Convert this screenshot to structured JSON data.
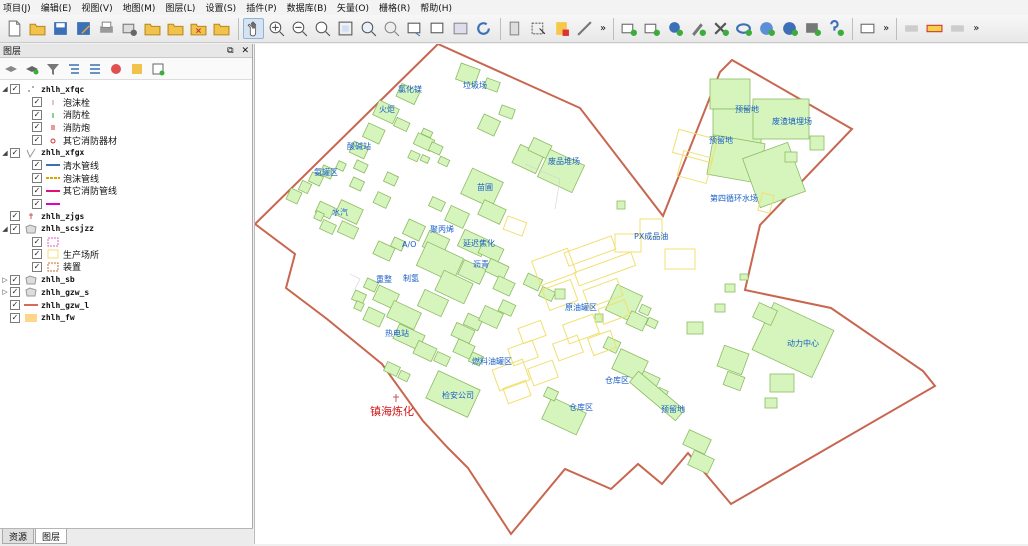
{
  "menu": [
    "项目(J)",
    "编辑(E)",
    "视图(V)",
    "地图(M)",
    "图层(L)",
    "设置(S)",
    "插件(P)",
    "数据库(B)",
    "矢量(O)",
    "栅格(R)",
    "帮助(H)"
  ],
  "toolbar": {
    "more1": "»",
    "more2": "»",
    "more3": "»"
  },
  "panel": {
    "title": "图层",
    "float_glyph": "⧉",
    "close_glyph": "✕"
  },
  "layers": {
    "xfqc": {
      "name": "zhlh_xfqc",
      "items": [
        "泡沫栓",
        "消防栓",
        "消防炮",
        "其它消防器材"
      ]
    },
    "xfgx": {
      "name": "zhlh_xfgx",
      "items": [
        "清水管线",
        "泡沫管线",
        "其它消防管线",
        ""
      ]
    },
    "zjgs": {
      "name": "zhlh_zjgs"
    },
    "scsjzz": {
      "name": "zhlh_scsjzz",
      "items": [
        "",
        "生产场所",
        "装置"
      ]
    },
    "sb": {
      "name": "zhlh_sb"
    },
    "gzw_s": {
      "name": "zhlh_gzw_s"
    },
    "gzw_l": {
      "name": "zhlh_gzw_l"
    },
    "fw": {
      "name": "zhlh_fw"
    }
  },
  "tabs": {
    "resource": "资源",
    "layers": "图层"
  },
  "map": {
    "labels": [
      {
        "t": "垃圾场"
      },
      {
        "t": "氯化镁"
      },
      {
        "t": "火炬"
      },
      {
        "t": "酸碱站"
      },
      {
        "t": "氨罐区"
      },
      {
        "t": "水汽"
      },
      {
        "t": "苗圃"
      },
      {
        "t": "废品堆场"
      },
      {
        "t": "聚丙烯"
      },
      {
        "t": "延迟焦化"
      },
      {
        "t": "A/O"
      },
      {
        "t": "沥青"
      },
      {
        "t": "重整"
      },
      {
        "t": "制氢"
      },
      {
        "t": "PX成品油"
      },
      {
        "t": "原油罐区"
      },
      {
        "t": "热电站"
      },
      {
        "t": "燃料油罐区"
      },
      {
        "t": "仓库区"
      },
      {
        "t": "检安公司"
      },
      {
        "t": "仓库区"
      },
      {
        "t": "预留地"
      },
      {
        "t": "预留地"
      },
      {
        "t": "废渣填埋场"
      },
      {
        "t": "预留地"
      },
      {
        "t": "第四循环水场"
      },
      {
        "t": "动力中心"
      },
      {
        "t": "镇海炼化"
      }
    ],
    "colors": {
      "boundary": "#c8664f",
      "building_fill": "#d6f5bd",
      "building_stroke": "#8dbb63",
      "label": "#1a5fc7",
      "label_red": "#d01818"
    }
  }
}
